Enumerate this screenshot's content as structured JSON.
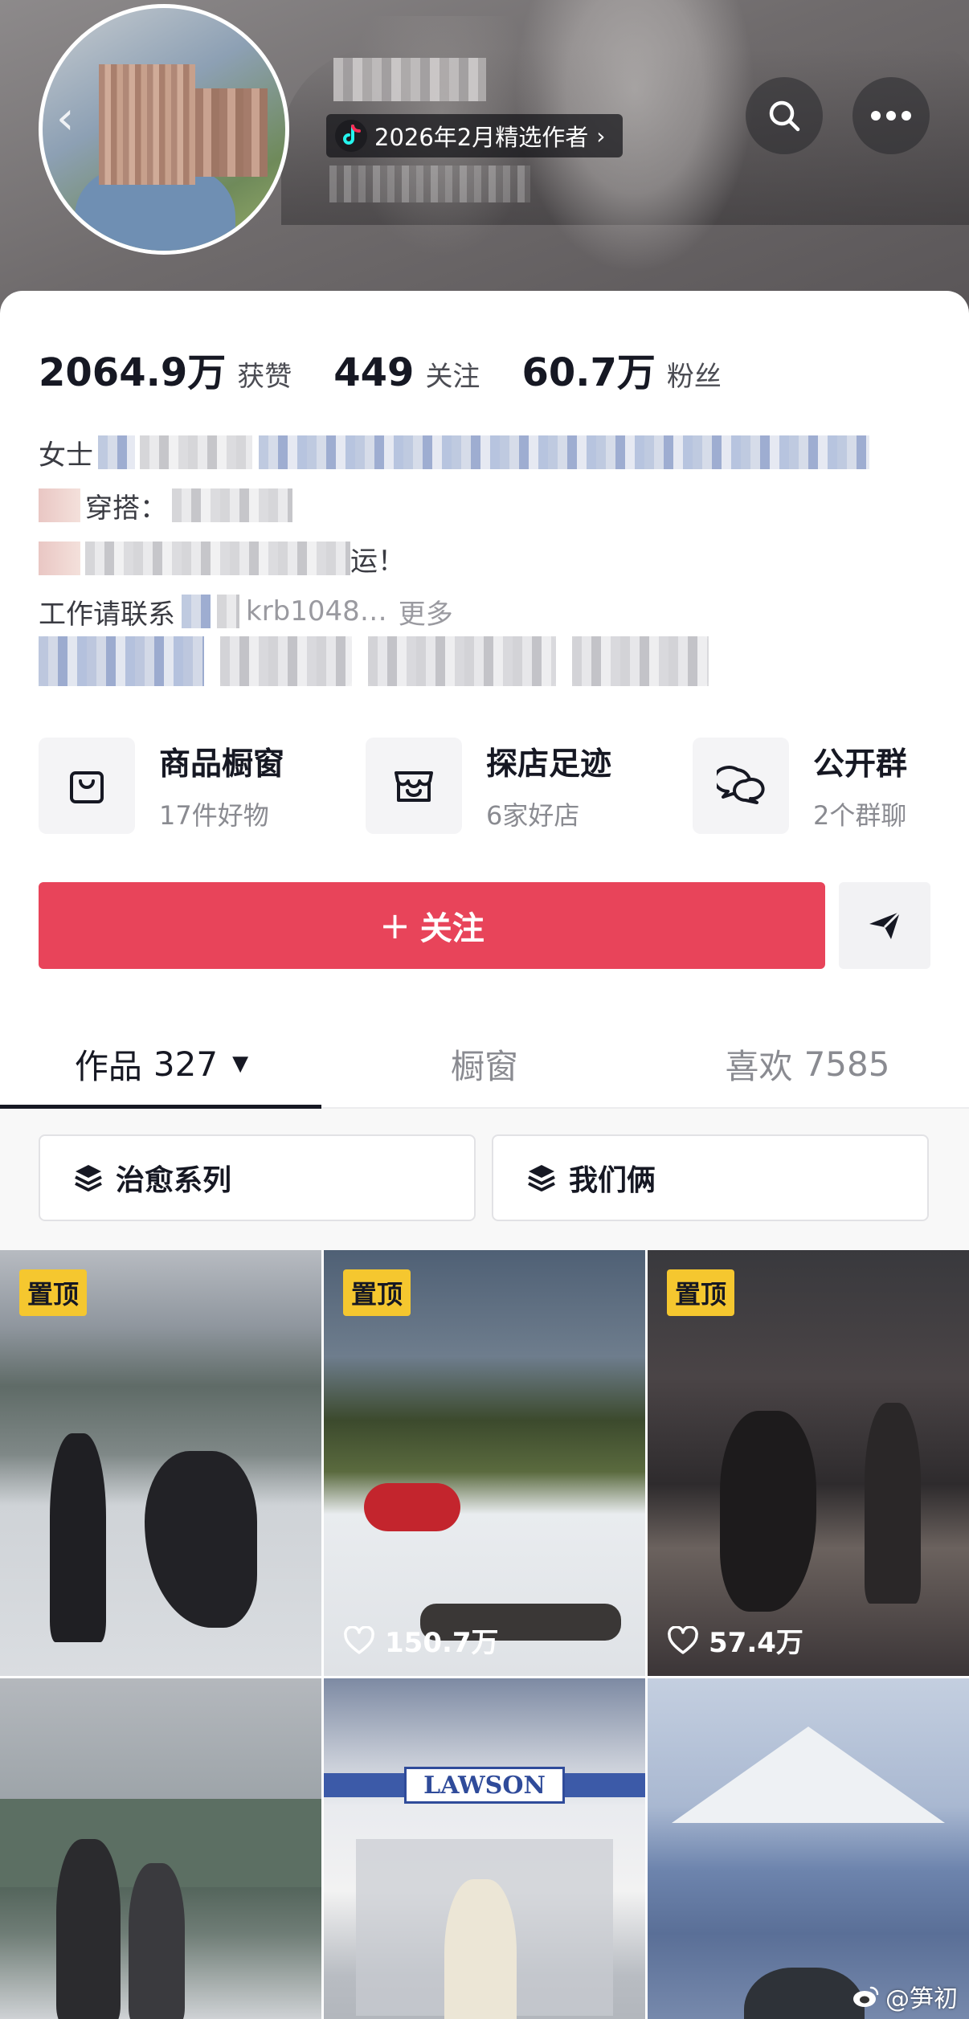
{
  "header": {
    "badge_text": "2026年2月精选作者",
    "badge_chevron": "›",
    "back_glyph": "‹"
  },
  "stats": [
    {
      "value": "2064.9万",
      "label": "获赞"
    },
    {
      "value": "449",
      "label": "关注"
    },
    {
      "value": "60.7万",
      "label": "粉丝"
    }
  ],
  "bio": {
    "line1_prefix": "女士",
    "line2_prefix": "穿搭：",
    "line3_suffix": "运！",
    "work_prefix": "工作请联系",
    "work_contact": "krb1048…",
    "more_label": "更多"
  },
  "features": [
    {
      "title": "商品橱窗",
      "subtitle": "17件好物",
      "icon": "bag-icon"
    },
    {
      "title": "探店足迹",
      "subtitle": "6家好店",
      "icon": "shop-icon"
    },
    {
      "title": "公开群",
      "subtitle": "2个群聊",
      "icon": "chat-bubbles-icon"
    }
  ],
  "follow": {
    "plus": "+",
    "label": "关注"
  },
  "tabs": [
    {
      "label": "作品",
      "count": "327",
      "caret": "▼",
      "active": true
    },
    {
      "label": "橱窗",
      "count": "",
      "active": false
    },
    {
      "label": "喜欢",
      "count": "7585",
      "active": false
    }
  ],
  "collections": [
    {
      "label": "治愈系列"
    },
    {
      "label": "我们俩"
    }
  ],
  "videos": [
    {
      "pinned_label": "置顶",
      "likes": ""
    },
    {
      "pinned_label": "置顶",
      "likes": "150.7万"
    },
    {
      "pinned_label": "置顶",
      "likes": "57.4万"
    },
    {
      "pinned_label": "",
      "likes": ""
    },
    {
      "pinned_label": "",
      "likes": "",
      "sign_text": "LAWSON"
    },
    {
      "pinned_label": "",
      "likes": ""
    }
  ],
  "watermark": "@笋初",
  "colors": {
    "follow_button": "#e8445a",
    "pin_badge": "#f5c72f",
    "text_primary": "#161823",
    "text_secondary": "#8a8b91"
  }
}
